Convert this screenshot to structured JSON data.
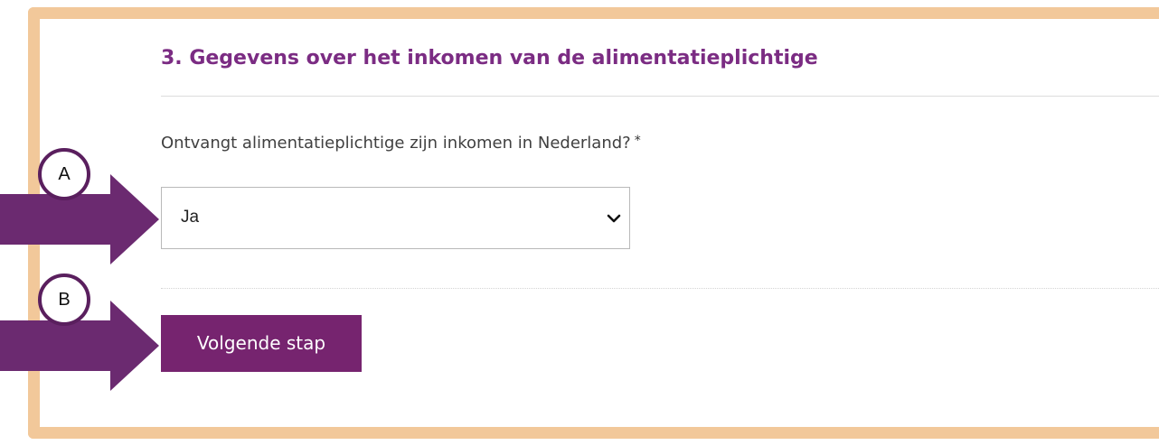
{
  "section": {
    "title": "3. Gegevens over het inkomen van de alimentatieplichtige"
  },
  "form": {
    "question_label": "Ontvangt alimentatieplichtige zijn inkomen in Nederland?",
    "required_marker": "*",
    "select_value": "Ja",
    "next_button_label": "Volgende stap"
  },
  "annotations": {
    "marker_a": "A",
    "marker_b": "B"
  },
  "colors": {
    "frame": "#f2c89a",
    "accent_purple": "#7b2c83",
    "button_purple": "#76246f",
    "arrow_purple": "#6b2a70"
  },
  "icons": {
    "select_chevron": "chevron-down-icon",
    "arrow": "arrow-right-icon"
  }
}
